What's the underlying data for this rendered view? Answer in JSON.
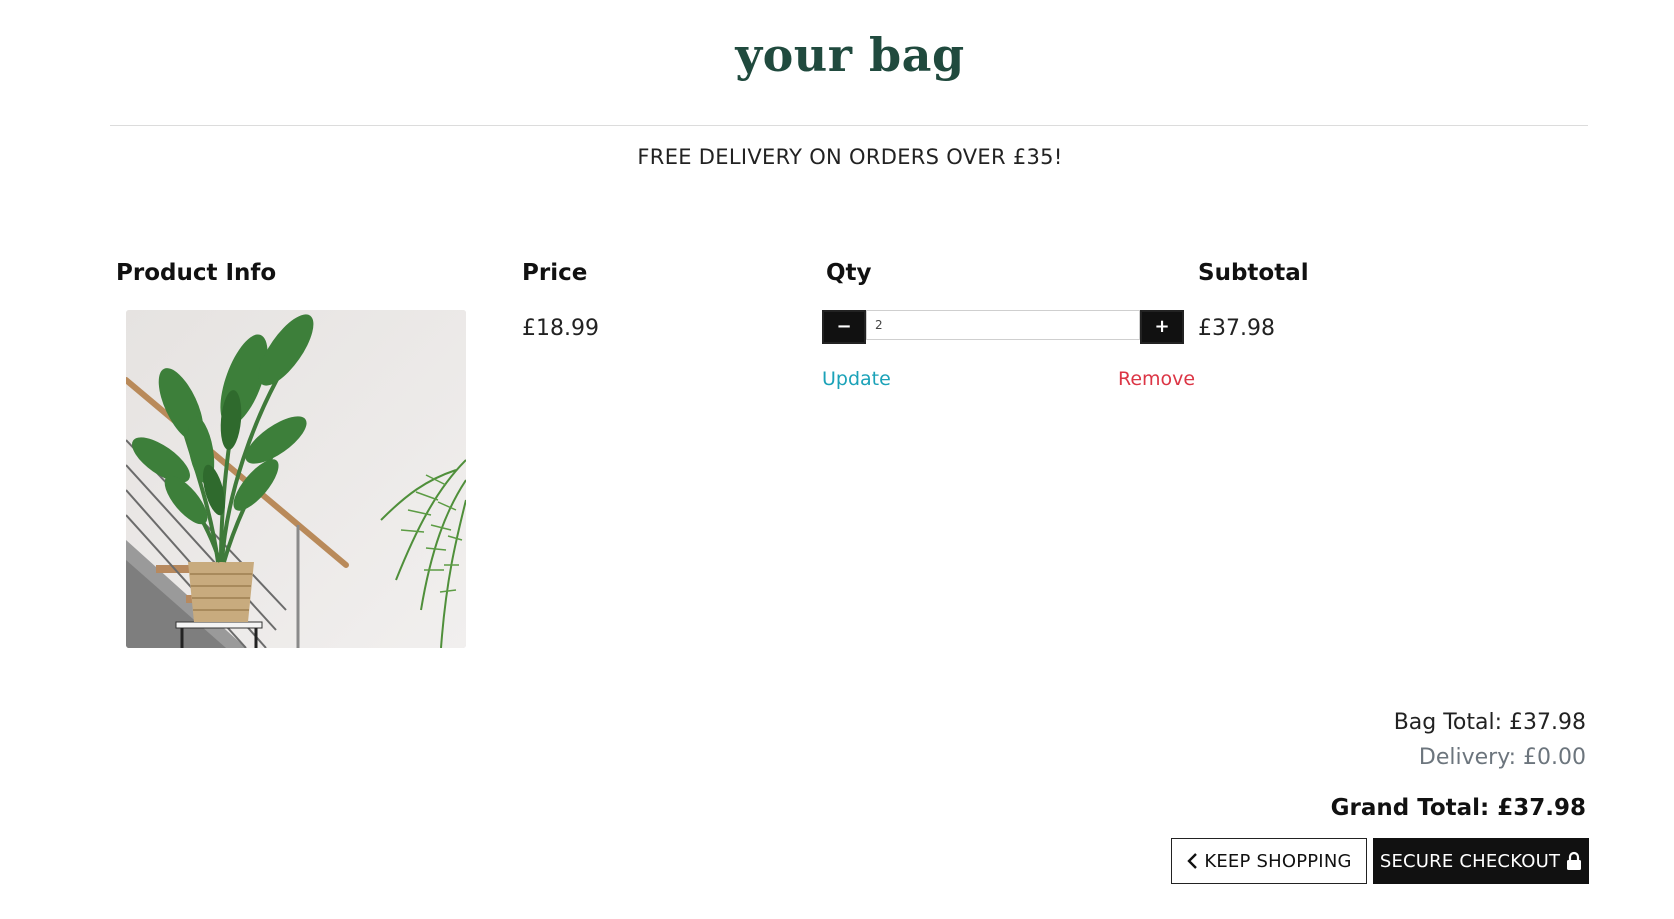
{
  "header": {
    "title": "your bag",
    "promo": "FREE DELIVERY ON ORDERS OVER £35!"
  },
  "table": {
    "headers": {
      "product": "Product Info",
      "price": "Price",
      "qty": "Qty",
      "subtotal": "Subtotal"
    },
    "item": {
      "image_icon": "plant-photo",
      "price": "£18.99",
      "qty": "2",
      "subtotal": "£37.98",
      "minus_label": "−",
      "plus_label": "+",
      "update_label": "Update",
      "remove_label": "Remove"
    }
  },
  "totals": {
    "bag_total": "Bag Total: £37.98",
    "delivery": "Delivery: £0.00",
    "grand_total": "Grand Total: £37.98"
  },
  "actions": {
    "keep_shopping": "KEEP SHOPPING",
    "secure_checkout": "SECURE CHECKOUT",
    "keep_icon": "chevron-left-icon",
    "checkout_icon": "lock-icon"
  },
  "colors": {
    "title": "#204a3e",
    "update": "#1ba2b8",
    "remove": "#dc3545",
    "muted": "#6c757d"
  }
}
